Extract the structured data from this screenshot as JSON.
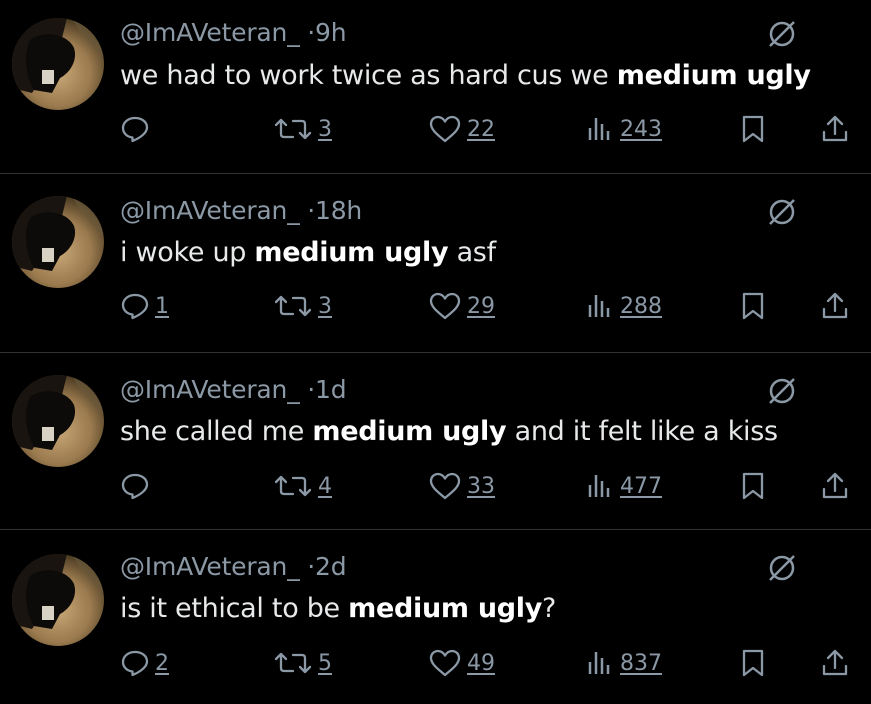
{
  "colors": {
    "background": "#000000",
    "text": "#e7e9ea",
    "secondary": "#8b98a5",
    "divider": "#2f3336"
  },
  "icons": [
    "mute-icon",
    "reply-icon",
    "retweet-icon",
    "like-icon",
    "views-icon",
    "bookmark-icon",
    "share-icon"
  ],
  "tweets": [
    {
      "handle": "@ImAVeteran_",
      "time": "9h",
      "text_before": "we had to work twice as hard cus we ",
      "text_bold": "medium ugly",
      "text_after": "",
      "replies": "",
      "retweets": "3",
      "likes": "22",
      "views": "243"
    },
    {
      "handle": "@ImAVeteran_",
      "time": "18h",
      "text_before": "i woke up ",
      "text_bold": "medium ugly",
      "text_after": " asf",
      "replies": "1",
      "retweets": "3",
      "likes": "29",
      "views": "288"
    },
    {
      "handle": "@ImAVeteran_",
      "time": "1d",
      "text_before": "she called me ",
      "text_bold": "medium ugly",
      "text_after": " and it felt like a kiss",
      "replies": "",
      "retweets": "4",
      "likes": "33",
      "views": "477"
    },
    {
      "handle": "@ImAVeteran_",
      "time": "2d",
      "text_before": "is it ethical to be ",
      "text_bold": "medium ugly",
      "text_after": "?",
      "replies": "2",
      "retweets": "5",
      "likes": "49",
      "views": "837"
    }
  ]
}
